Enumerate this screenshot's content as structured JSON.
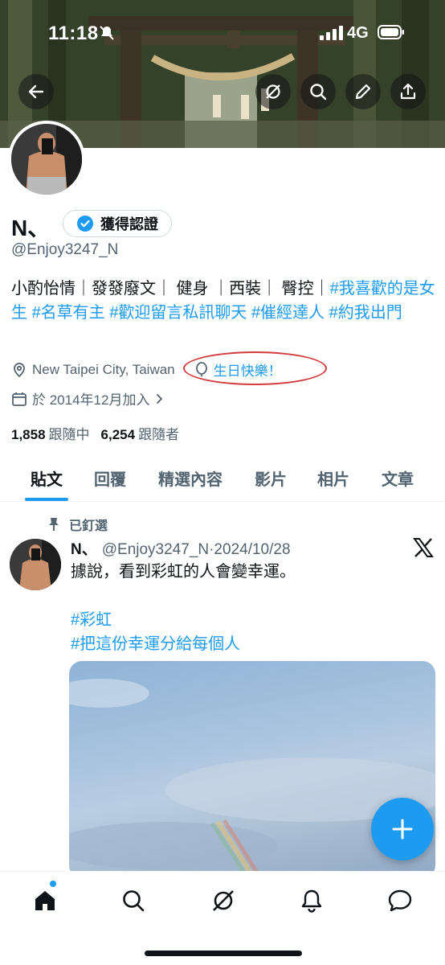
{
  "status_bar": {
    "time": "11:18",
    "network": "4G"
  },
  "profile": {
    "display_name": "N、",
    "verified_button": "獲得認證",
    "handle": "@Enjoy3247_N",
    "bio_plain": "小酌怡情｜發發廢文｜ 健身 ｜西裝｜ 臀控｜",
    "bio_tags": [
      "#我喜歡的是女生",
      "#名草有主",
      "#歡迎留言私訊聊天",
      "#催經達人",
      "#約我出門"
    ],
    "location": "New Taipei City, Taiwan",
    "birthday": "生日快樂！",
    "joined": "於 2014年12月加入",
    "following_count": "1,858",
    "following_label": "跟隨中",
    "followers_count": "6,254",
    "followers_label": "跟隨者"
  },
  "tabs": [
    "貼文",
    "回覆",
    "精選內容",
    "影片",
    "相片",
    "文章"
  ],
  "active_tab": "貼文",
  "post": {
    "pinned_label": "已釘選",
    "author": "N、",
    "handle": "@Enjoy3247_N",
    "date": "·2024/10/28",
    "text": "據說，看到彩虹的人會變幸運。",
    "tag1": "#彩虹",
    "tag2": "#把這份幸運分給每個人"
  },
  "colors": {
    "accent": "#1d9bf0",
    "text": "#0f1419",
    "secondary": "#536471",
    "annotation": "#d23c3c"
  },
  "icons": {
    "header": [
      "back-arrow-icon",
      "grok-icon",
      "search-icon",
      "edit-icon",
      "share-icon"
    ],
    "nav": [
      "home-icon",
      "search-icon",
      "grok-icon",
      "bell-icon",
      "messages-icon"
    ]
  }
}
